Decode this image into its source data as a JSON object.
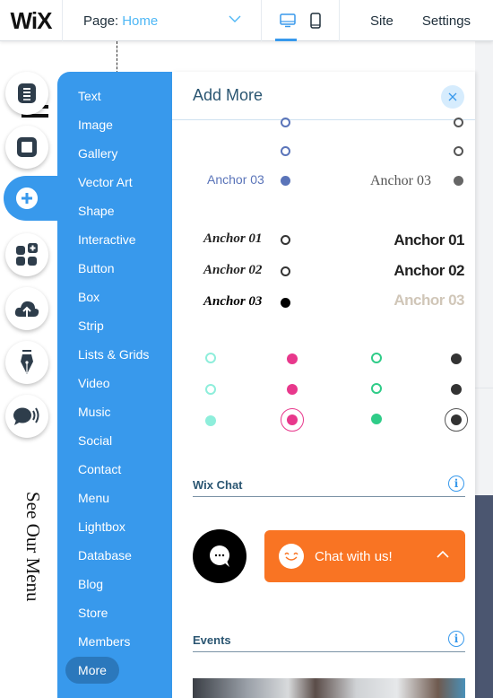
{
  "topbar": {
    "logo": "WiX",
    "page_label": "Page:",
    "page_value": "Home",
    "devices": [
      {
        "name": "desktop",
        "icon": "desktop-icon",
        "active": true
      },
      {
        "name": "mobile",
        "icon": "mobile-icon",
        "active": false
      }
    ],
    "site_label": "Site",
    "settings_label": "Settings"
  },
  "canvas": {
    "vertical_text": "See Our Menu"
  },
  "rail": {
    "items": [
      {
        "icon": "pages-icon",
        "label": "Pages"
      },
      {
        "icon": "background-icon",
        "label": "Background"
      },
      {
        "icon": "add-icon",
        "label": "Add",
        "active": true
      },
      {
        "icon": "add-apps-icon",
        "label": "Add Apps"
      },
      {
        "icon": "upload-icon",
        "label": "Media"
      },
      {
        "icon": "pen-icon",
        "label": "Blog"
      },
      {
        "icon": "chat-icon",
        "label": "Engage"
      }
    ]
  },
  "categories": {
    "items": [
      "Text",
      "Image",
      "Gallery",
      "Vector Art",
      "Shape",
      "Interactive",
      "Button",
      "Box",
      "Strip",
      "Lists & Grids",
      "Video",
      "Music",
      "Social",
      "Contact",
      "Menu",
      "Lightbox",
      "Database",
      "Blog",
      "Store",
      "Members"
    ],
    "selected": "More"
  },
  "add_panel": {
    "title": "Add More",
    "anchor_menus": {
      "blue_left": {
        "label": "Anchor 03",
        "color": "#5a74b9"
      },
      "serif_right": {
        "label": "Anchor 03",
        "color": "#555555"
      },
      "italic_left": [
        "Anchor 01",
        "Anchor 02",
        "Anchor 03"
      ],
      "bold_right": [
        "Anchor 01",
        "Anchor 02",
        "Anchor 03"
      ],
      "bold_right_inactive_color": "#d0c6b8"
    },
    "dot_colors": {
      "teal": "#8eeedb",
      "pink": "#e8388c",
      "green": "#2fcc88",
      "dark": "#333333"
    },
    "wix_chat": {
      "title": "Wix Chat",
      "chat_label": "Chat with us!",
      "accent": "#f97423"
    },
    "events": {
      "title": "Events"
    }
  }
}
